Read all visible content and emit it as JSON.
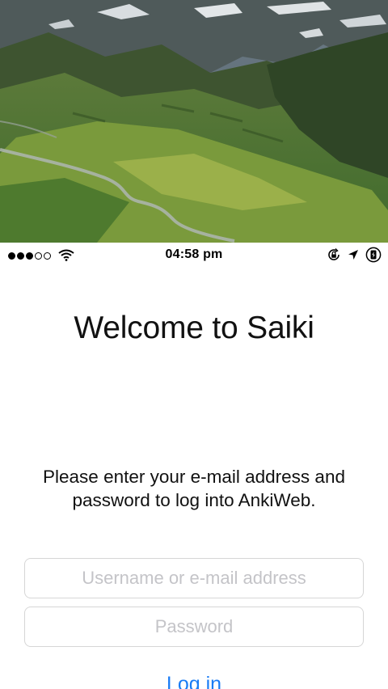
{
  "status_bar": {
    "signal_bars": 5,
    "signal_filled": 3,
    "time": "04:58 pm",
    "icons": [
      "wifi-icon",
      "rotation-lock-icon",
      "location-arrow-icon",
      "battery-charging-icon"
    ]
  },
  "hero": {
    "icon": "mountain-landscape-image"
  },
  "main": {
    "title": "Welcome to Saiki",
    "instructions": "Please enter your e-mail address and password to log into AnkiWeb.",
    "username_placeholder": "Username or e-mail address",
    "password_placeholder": "Password",
    "login_label": "Log in"
  },
  "colors": {
    "link": "#1a7cf5",
    "field_border": "#d6d6d6",
    "placeholder": "#c4c4c8"
  }
}
